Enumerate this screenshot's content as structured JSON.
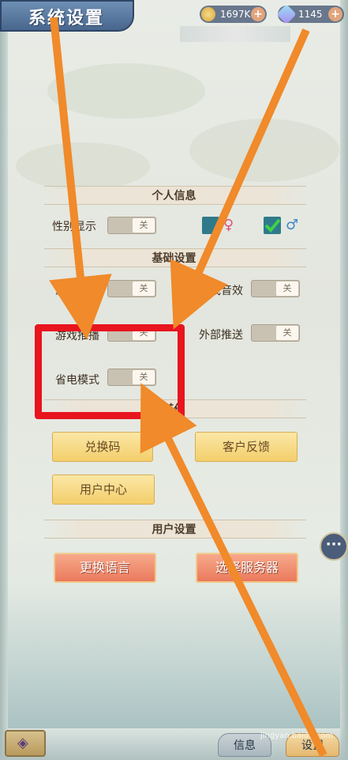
{
  "header": {
    "title": "系统设置",
    "coins": {
      "icon": "coin-icon",
      "value": "1697K"
    },
    "gems": {
      "icon": "gem-icon",
      "value": "1145"
    }
  },
  "sections": {
    "personal": "个人信息",
    "basic": "基础设置",
    "other": "其他",
    "user": "用户设置"
  },
  "personal": {
    "gender_label": "性别显示",
    "gender_toggle": "关",
    "female_icon": "♀",
    "male_icon": "♂"
  },
  "basic": {
    "game_sound_label": "游戏音乐",
    "game_sound_toggle": "关",
    "game_effect_label": "游戏音效",
    "game_effect_toggle": "关",
    "game_push_label": "游戏推播",
    "game_push_toggle": "关",
    "external_push_label": "外部推送",
    "external_push_toggle": "关",
    "power_save_label": "省电模式",
    "power_save_toggle": "关"
  },
  "other_buttons": {
    "redeem": "兑换码",
    "feedback": "客户反馈",
    "user_center": "用户中心"
  },
  "user_buttons": {
    "language": "更换语言",
    "server": "选择服务器"
  },
  "bottom_nav": {
    "info": "信息",
    "settings": "设置"
  },
  "watermark": "jingyan.baidu.com",
  "colors": {
    "annotation_arrow": "#f08a2a",
    "annotation_box": "#e8141e"
  }
}
